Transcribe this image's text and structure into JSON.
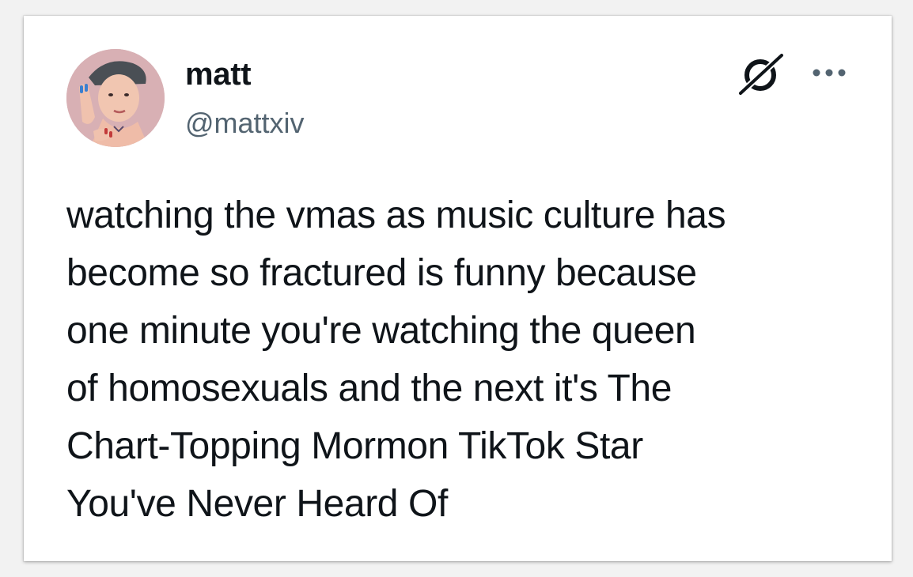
{
  "tweet": {
    "author": {
      "display_name": "matt",
      "handle": "@mattxiv",
      "avatar_icon": "avatar-photo"
    },
    "actions": {
      "grok_icon": "grok-icon",
      "more_icon": "more-icon"
    },
    "text_lines": [
      "watching the vmas as music culture has",
      "become so fractured is funny because",
      "one minute you're watching the queen",
      "of homosexuals and the next it's The",
      "Chart-Topping Mormon TikTok Star",
      "You've Never Heard Of"
    ]
  },
  "colors": {
    "text_primary": "#0f1419",
    "text_secondary": "#536471",
    "background": "#f2f2f2",
    "card": "#ffffff"
  }
}
